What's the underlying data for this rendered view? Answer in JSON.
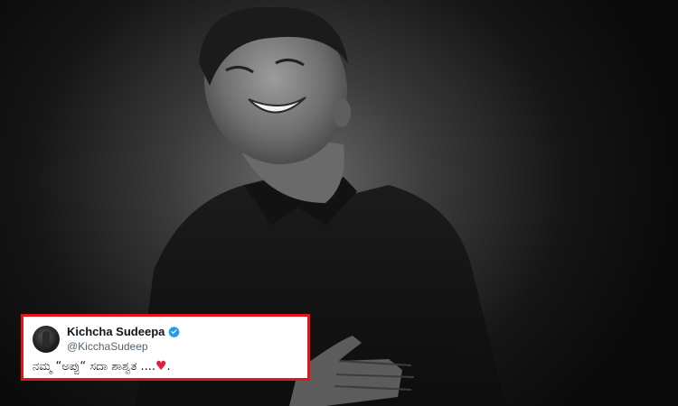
{
  "tweet": {
    "display_name": "Kichcha Sudeepa",
    "handle": "@KicchaSudeep",
    "text": "ನಮ್ಮ “ಅಪ್ಪು“ ಸದಾ ಶಾಶ್ವತ ....",
    "text_suffix": ".",
    "verified_icon": "verified-badge-icon",
    "heart_icon": "red-heart-icon",
    "border_color": "#e3141c",
    "verified_color": "#1d9bf0"
  },
  "photo": {
    "style": "black-and-white"
  }
}
